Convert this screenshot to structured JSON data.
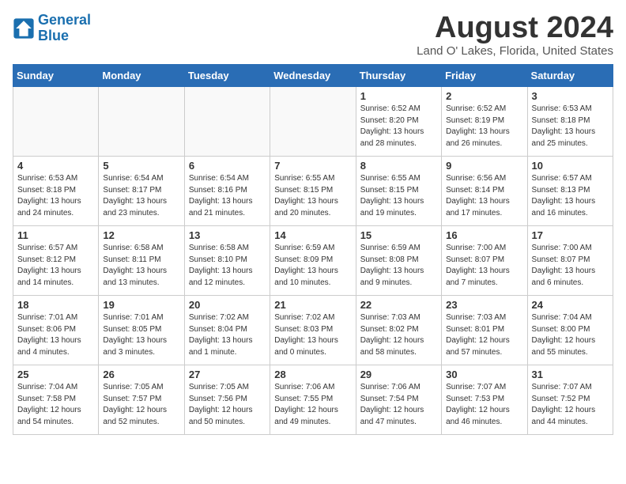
{
  "header": {
    "logo_line1": "General",
    "logo_line2": "Blue",
    "month_year": "August 2024",
    "location": "Land O' Lakes, Florida, United States"
  },
  "weekdays": [
    "Sunday",
    "Monday",
    "Tuesday",
    "Wednesday",
    "Thursday",
    "Friday",
    "Saturday"
  ],
  "weeks": [
    [
      {
        "day": "",
        "info": ""
      },
      {
        "day": "",
        "info": ""
      },
      {
        "day": "",
        "info": ""
      },
      {
        "day": "",
        "info": ""
      },
      {
        "day": "1",
        "info": "Sunrise: 6:52 AM\nSunset: 8:20 PM\nDaylight: 13 hours\nand 28 minutes."
      },
      {
        "day": "2",
        "info": "Sunrise: 6:52 AM\nSunset: 8:19 PM\nDaylight: 13 hours\nand 26 minutes."
      },
      {
        "day": "3",
        "info": "Sunrise: 6:53 AM\nSunset: 8:18 PM\nDaylight: 13 hours\nand 25 minutes."
      }
    ],
    [
      {
        "day": "4",
        "info": "Sunrise: 6:53 AM\nSunset: 8:18 PM\nDaylight: 13 hours\nand 24 minutes."
      },
      {
        "day": "5",
        "info": "Sunrise: 6:54 AM\nSunset: 8:17 PM\nDaylight: 13 hours\nand 23 minutes."
      },
      {
        "day": "6",
        "info": "Sunrise: 6:54 AM\nSunset: 8:16 PM\nDaylight: 13 hours\nand 21 minutes."
      },
      {
        "day": "7",
        "info": "Sunrise: 6:55 AM\nSunset: 8:15 PM\nDaylight: 13 hours\nand 20 minutes."
      },
      {
        "day": "8",
        "info": "Sunrise: 6:55 AM\nSunset: 8:15 PM\nDaylight: 13 hours\nand 19 minutes."
      },
      {
        "day": "9",
        "info": "Sunrise: 6:56 AM\nSunset: 8:14 PM\nDaylight: 13 hours\nand 17 minutes."
      },
      {
        "day": "10",
        "info": "Sunrise: 6:57 AM\nSunset: 8:13 PM\nDaylight: 13 hours\nand 16 minutes."
      }
    ],
    [
      {
        "day": "11",
        "info": "Sunrise: 6:57 AM\nSunset: 8:12 PM\nDaylight: 13 hours\nand 14 minutes."
      },
      {
        "day": "12",
        "info": "Sunrise: 6:58 AM\nSunset: 8:11 PM\nDaylight: 13 hours\nand 13 minutes."
      },
      {
        "day": "13",
        "info": "Sunrise: 6:58 AM\nSunset: 8:10 PM\nDaylight: 13 hours\nand 12 minutes."
      },
      {
        "day": "14",
        "info": "Sunrise: 6:59 AM\nSunset: 8:09 PM\nDaylight: 13 hours\nand 10 minutes."
      },
      {
        "day": "15",
        "info": "Sunrise: 6:59 AM\nSunset: 8:08 PM\nDaylight: 13 hours\nand 9 minutes."
      },
      {
        "day": "16",
        "info": "Sunrise: 7:00 AM\nSunset: 8:07 PM\nDaylight: 13 hours\nand 7 minutes."
      },
      {
        "day": "17",
        "info": "Sunrise: 7:00 AM\nSunset: 8:07 PM\nDaylight: 13 hours\nand 6 minutes."
      }
    ],
    [
      {
        "day": "18",
        "info": "Sunrise: 7:01 AM\nSunset: 8:06 PM\nDaylight: 13 hours\nand 4 minutes."
      },
      {
        "day": "19",
        "info": "Sunrise: 7:01 AM\nSunset: 8:05 PM\nDaylight: 13 hours\nand 3 minutes."
      },
      {
        "day": "20",
        "info": "Sunrise: 7:02 AM\nSunset: 8:04 PM\nDaylight: 13 hours\nand 1 minute."
      },
      {
        "day": "21",
        "info": "Sunrise: 7:02 AM\nSunset: 8:03 PM\nDaylight: 13 hours\nand 0 minutes."
      },
      {
        "day": "22",
        "info": "Sunrise: 7:03 AM\nSunset: 8:02 PM\nDaylight: 12 hours\nand 58 minutes."
      },
      {
        "day": "23",
        "info": "Sunrise: 7:03 AM\nSunset: 8:01 PM\nDaylight: 12 hours\nand 57 minutes."
      },
      {
        "day": "24",
        "info": "Sunrise: 7:04 AM\nSunset: 8:00 PM\nDaylight: 12 hours\nand 55 minutes."
      }
    ],
    [
      {
        "day": "25",
        "info": "Sunrise: 7:04 AM\nSunset: 7:58 PM\nDaylight: 12 hours\nand 54 minutes."
      },
      {
        "day": "26",
        "info": "Sunrise: 7:05 AM\nSunset: 7:57 PM\nDaylight: 12 hours\nand 52 minutes."
      },
      {
        "day": "27",
        "info": "Sunrise: 7:05 AM\nSunset: 7:56 PM\nDaylight: 12 hours\nand 50 minutes."
      },
      {
        "day": "28",
        "info": "Sunrise: 7:06 AM\nSunset: 7:55 PM\nDaylight: 12 hours\nand 49 minutes."
      },
      {
        "day": "29",
        "info": "Sunrise: 7:06 AM\nSunset: 7:54 PM\nDaylight: 12 hours\nand 47 minutes."
      },
      {
        "day": "30",
        "info": "Sunrise: 7:07 AM\nSunset: 7:53 PM\nDaylight: 12 hours\nand 46 minutes."
      },
      {
        "day": "31",
        "info": "Sunrise: 7:07 AM\nSunset: 7:52 PM\nDaylight: 12 hours\nand 44 minutes."
      }
    ]
  ]
}
